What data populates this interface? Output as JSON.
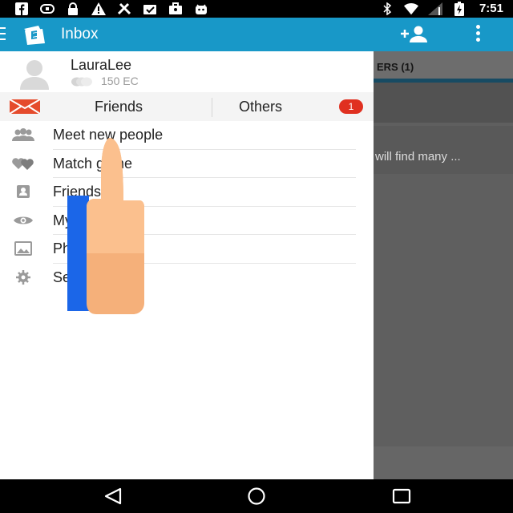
{
  "status_bar": {
    "time": "7:51",
    "left_icons": [
      "facebook-icon",
      "sync-icon",
      "lock-icon",
      "warning-icon",
      "tools-icon",
      "checklist-icon",
      "briefcase-icon",
      "android-icon"
    ],
    "right_icons": [
      "bluetooth-icon",
      "wifi-icon",
      "signal-icon",
      "battery-charging-icon"
    ]
  },
  "app_bar": {
    "title": "Inbox",
    "color": "#1898c8"
  },
  "profile": {
    "username": "LauraLee",
    "credits": "150 EC"
  },
  "tabs": {
    "friends_label": "Friends",
    "others_label": "Others",
    "others_badge": "1"
  },
  "menu": [
    {
      "label": "Meet new people",
      "icon": "people-icon"
    },
    {
      "label": "Match game",
      "icon": "hearts-icon"
    },
    {
      "label": "Friends",
      "icon": "contact-card-icon"
    },
    {
      "label": "My visitors",
      "icon": "eye-icon"
    },
    {
      "label": "Photo rates",
      "icon": "photos-icon"
    },
    {
      "label": "Settings",
      "icon": "gear-icon"
    }
  ],
  "background": {
    "tab_label": "ERS (1)",
    "preview_text": "will find many ..."
  }
}
